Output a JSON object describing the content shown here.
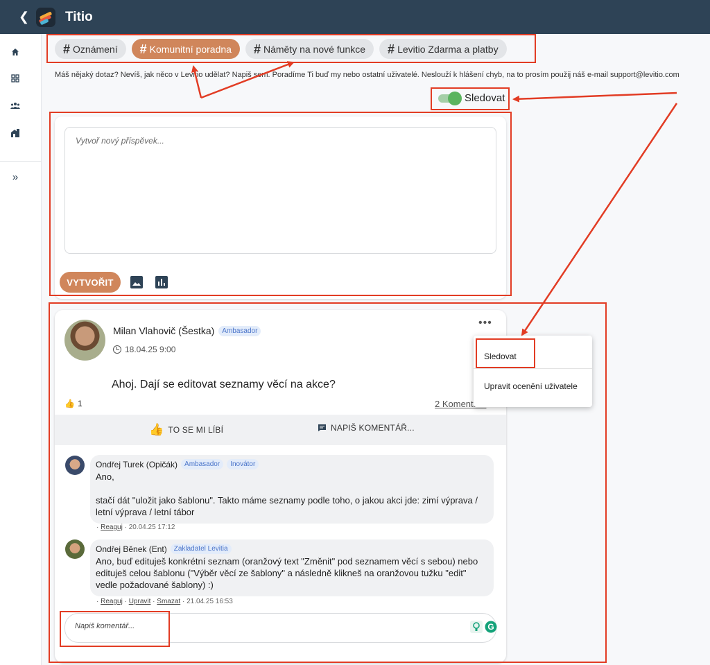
{
  "app": {
    "title": "Titio"
  },
  "channels": [
    {
      "label": "Oznámení",
      "active": false
    },
    {
      "label": "Komunitní poradna",
      "active": true
    },
    {
      "label": "Náměty na nové funkce",
      "active": false
    },
    {
      "label": "Levitio Zdarma a platby",
      "active": false
    }
  ],
  "info_text": "Máš nějaký dotaz? Nevíš, jak něco v Levitio udělat? Napiš sem. Poradíme Ti buď my nebo ostatní uživatelé. Neslouží k hlášení chyb, na to prosím použij náš e-mail support@levitio.com",
  "follow": {
    "label": "Sledovat",
    "on": true
  },
  "composer": {
    "placeholder": "Vytvoř nový příspěvek...",
    "create_label": "VYTVOŘIT"
  },
  "post": {
    "author": "Milan Vlahovič (Šestka)",
    "badge": "Ambasador",
    "date": "18.04.25 9:00",
    "text": "Ahoj. Dají se editovat seznamy věcí na akce?",
    "likes": "1",
    "comments_count": "2 Komentáře",
    "like_label": "TO SE MI LÍBÍ",
    "comment_label": "NAPIŠ KOMENTÁŘ...",
    "menu": {
      "follow": "Sledovat",
      "edit_award": "Upravit ocenění uživatele"
    }
  },
  "comments": [
    {
      "author": "Ondřej Turek (Opičák)",
      "badges": [
        "Ambasador",
        "Inovátor"
      ],
      "text": "Ano,\n\nstačí dát \"uložit jako šablonu\". Takto máme seznamy podle toho, o jakou akci jde: zimí výprava / letní výprava / letní tábor",
      "reply": "Reaguj",
      "date": "20.04.25 17:12"
    },
    {
      "author": "Ondřej Běnek (Ent)",
      "badges": [
        "Zakladatel Levitia"
      ],
      "text": "Ano, buď edituješ konkrétní seznam (oranžový text \"Změnit\" pod seznamem věcí s sebou) nebo edituješ celou šablonu (\"Výběr věcí ze šablony\" a následně klikneš na oranžovou tužku \"edit\" vedle požadované šablony) :)",
      "reply": "Reaguj",
      "edit": "Upravit",
      "delete": "Smazat",
      "date": "21.04.25 16:53"
    }
  ],
  "comment_input": {
    "placeholder": "Napiš komentář..."
  },
  "colors": {
    "header": "#2e4356",
    "accent": "#d0865b",
    "annotation": "#e23c24",
    "toggle": "#5bb45f"
  }
}
